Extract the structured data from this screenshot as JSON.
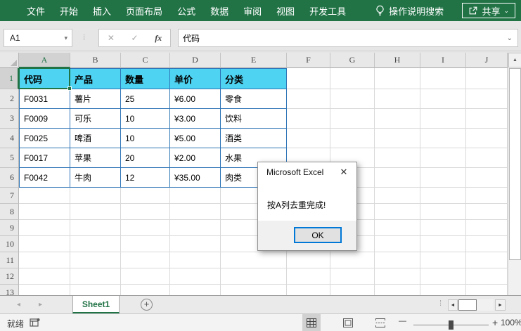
{
  "ribbon": {
    "tabs": [
      {
        "label": "文件"
      },
      {
        "label": "开始"
      },
      {
        "label": "插入"
      },
      {
        "label": "页面布局"
      },
      {
        "label": "公式"
      },
      {
        "label": "数据"
      },
      {
        "label": "审阅"
      },
      {
        "label": "视图"
      },
      {
        "label": "开发工具"
      }
    ],
    "tell_me_label": "操作说明搜索",
    "share_label": "共享"
  },
  "formula_bar": {
    "name_box_value": "A1",
    "formula_value": "代码"
  },
  "grid": {
    "columns": [
      "A",
      "B",
      "C",
      "D",
      "E",
      "F",
      "G",
      "H",
      "I",
      "J"
    ],
    "row_labels": [
      "1",
      "2",
      "3",
      "4",
      "5",
      "6",
      "7",
      "8",
      "9",
      "10",
      "11",
      "12",
      "13"
    ],
    "selected_cell": "A1",
    "table": {
      "headers": [
        "代码",
        "产品",
        "数量",
        "单价",
        "分类"
      ],
      "data": [
        [
          "F0031",
          "薯片",
          "25",
          "¥6.00",
          "零食"
        ],
        [
          "F0009",
          "可乐",
          "10",
          "¥3.00",
          "饮料"
        ],
        [
          "F0025",
          "啤酒",
          "10",
          "¥5.00",
          "酒类"
        ],
        [
          "F0017",
          "苹果",
          "20",
          "¥2.00",
          "水果"
        ],
        [
          "F0042",
          "牛肉",
          "12",
          "¥35.00",
          "肉类"
        ]
      ]
    }
  },
  "dialog": {
    "title": "Microsoft Excel",
    "message": "按A列去重完成!",
    "ok_label": "OK"
  },
  "sheet_bar": {
    "active_sheet": "Sheet1",
    "add_label": "+"
  },
  "status_bar": {
    "ready_label": "就绪",
    "zoom_level": "100%"
  },
  "icons": {
    "name_box_dropdown": "▾",
    "cancel": "✕",
    "enter": "✓",
    "fx": "fx",
    "formula_expand": "⌄",
    "drag_handle": "⁞",
    "share_chevron": "⌄",
    "dialog_close": "✕",
    "nav_left": "◂",
    "nav_right": "▸",
    "scroll_up": "▲",
    "scroll_down": "▼",
    "scroll_left": "◄",
    "scroll_right": "►",
    "zoom_out": "—",
    "zoom_in": "+"
  },
  "colors": {
    "ribbon_green": "#217346",
    "selection_green": "#217346",
    "table_header_fill": "#4ed3f2",
    "table_border": "#2e75b6",
    "ok_focus_border": "#0078d7"
  }
}
